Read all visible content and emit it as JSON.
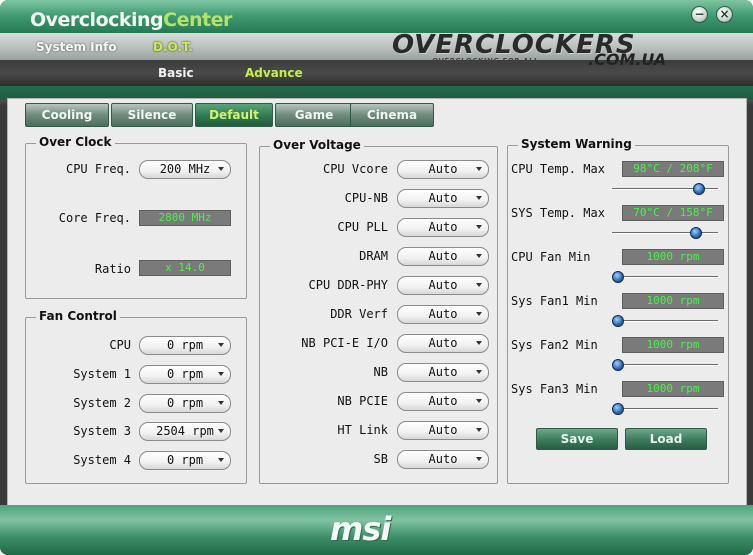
{
  "window": {
    "title_part1": "Overclocking",
    "title_part2": "Center",
    "minimize_glyph": "−",
    "close_glyph": "×"
  },
  "nav": {
    "system_info": "System Info",
    "dot": "D.O.T.",
    "basic": "Basic",
    "advance": "Advance"
  },
  "brand": {
    "name": "OVERCLOCKERS",
    "tagline": "OVERCLOCKING FOR ALL",
    "domain": ".COM.UA"
  },
  "tabs": [
    "Cooling",
    "Silence",
    "Default",
    "Game",
    "Cinema"
  ],
  "active_tab": "Default",
  "over_clock": {
    "title": "Over Clock",
    "cpu_freq_label": "CPU Freq.",
    "cpu_freq_value": "200 MHz",
    "core_freq_label": "Core Freq.",
    "core_freq_value": "2800 MHz",
    "ratio_label": "Ratio",
    "ratio_value": "x 14.0"
  },
  "fan_control": {
    "title": "Fan Control",
    "rows": [
      {
        "label": "CPU",
        "value": "0 rpm"
      },
      {
        "label": "System 1",
        "value": "0 rpm"
      },
      {
        "label": "System 2",
        "value": "0 rpm"
      },
      {
        "label": "System 3",
        "value": "2504 rpm"
      },
      {
        "label": "System 4",
        "value": "0 rpm"
      }
    ]
  },
  "over_voltage": {
    "title": "Over Voltage",
    "rows": [
      {
        "label": "CPU Vcore",
        "value": "Auto"
      },
      {
        "label": "CPU-NB",
        "value": "Auto"
      },
      {
        "label": "CPU PLL",
        "value": "Auto"
      },
      {
        "label": "DRAM",
        "value": "Auto"
      },
      {
        "label": "CPU DDR-PHY",
        "value": "Auto"
      },
      {
        "label": "DDR Verf",
        "value": "Auto"
      },
      {
        "label": "NB PCI-E I/O",
        "value": "Auto"
      },
      {
        "label": "NB",
        "value": "Auto"
      },
      {
        "label": "NB PCIE",
        "value": "Auto"
      },
      {
        "label": "HT Link",
        "value": "Auto"
      },
      {
        "label": "SB",
        "value": "Auto"
      }
    ]
  },
  "system_warning": {
    "title": "System Warning",
    "rows": [
      {
        "label": "CPU Temp. Max",
        "value": "98°C / 208°F",
        "slider_fraction": 0.86
      },
      {
        "label": "SYS Temp. Max",
        "value": "70°C / 158°F",
        "slider_fraction": 0.83
      },
      {
        "label": "CPU Fan Min",
        "value": "1000 rpm",
        "slider_fraction": 0.0
      },
      {
        "label": "Sys Fan1 Min",
        "value": "1000 rpm",
        "slider_fraction": 0.0
      },
      {
        "label": "Sys Fan2 Min",
        "value": "1000 rpm",
        "slider_fraction": 0.0
      },
      {
        "label": "Sys Fan3 Min",
        "value": "1000 rpm",
        "slider_fraction": 0.0
      }
    ],
    "save_label": "Save",
    "load_label": "Load"
  },
  "footer": {
    "logo": "msi"
  },
  "colors": {
    "accent_green": "#b3e36a",
    "readout_green": "#49f24a",
    "active_tab_text": "#d9f26b"
  }
}
